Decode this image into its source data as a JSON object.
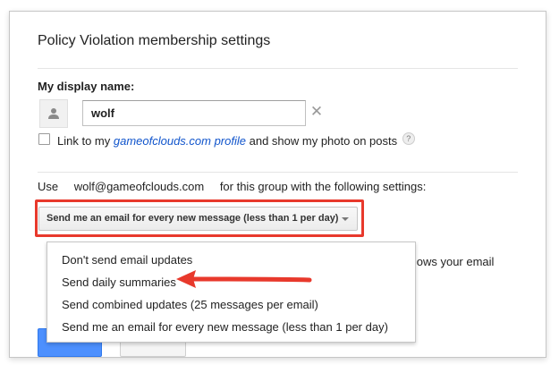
{
  "dialog": {
    "title": "Policy Violation membership settings"
  },
  "display_name": {
    "label": "My display name:",
    "value": "wolf",
    "clear_symbol": "✕",
    "avatar_icon": "person-icon"
  },
  "link_profile": {
    "prefix": "Link to my ",
    "link_text": "gameofclouds.com profile",
    "suffix": " and show my photo on posts",
    "help_symbol": "?"
  },
  "use_row": {
    "prefix": "Use",
    "email": "wolf@gameofclouds.com",
    "suffix": "for this group with the following settings:"
  },
  "email_setting": {
    "selected": "Send me an email for every new message (less than 1 per day)",
    "options": [
      "Don't send email updates",
      "Send daily summaries",
      "Send combined updates (25 messages per email)",
      "Send me an email for every new message (less than 1 per day)"
    ]
  },
  "background_text": "knows your email",
  "colors": {
    "highlight": "#e8392c",
    "link": "#1155cc",
    "primary_button": "#4d90fe"
  }
}
